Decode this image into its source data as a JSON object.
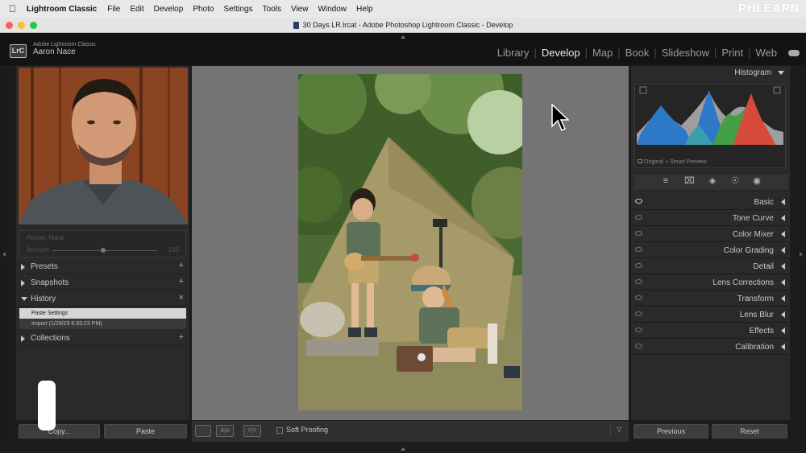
{
  "menubar": {
    "app": "Lightroom Classic",
    "items": [
      "File",
      "Edit",
      "Develop",
      "Photo",
      "Settings",
      "Tools",
      "View",
      "Window",
      "Help"
    ],
    "brand": "PHLEARN"
  },
  "window": {
    "title": "30 Days LR.lrcat - Adobe Photoshop Lightroom Classic - Develop"
  },
  "identity": {
    "badge": "LrC",
    "product": "Adobe Lightroom Classic",
    "user": "Aaron Nace"
  },
  "modules": [
    "Library",
    "Develop",
    "Map",
    "Book",
    "Slideshow",
    "Print",
    "Web"
  ],
  "active_module": "Develop",
  "left_panel": {
    "preset_name_label": "Preset: None",
    "amount_label": "Amount",
    "amount_value": "100",
    "sections": [
      {
        "label": "Presets",
        "action": "+"
      },
      {
        "label": "Snapshots",
        "action": "+"
      },
      {
        "label": "History",
        "action": "×"
      },
      {
        "label": "Collections",
        "action": "+"
      }
    ],
    "history_items": [
      "Paste Settings",
      "Import (1/29/25 6:33:23 PM)"
    ],
    "copy_label": "Copy...",
    "paste_label": "Paste"
  },
  "toolbar": {
    "view1": "",
    "view2": "A|A",
    "view3": "Y|Y",
    "soft_proofing": "Soft Proofing",
    "dropdown": "▽"
  },
  "right_panel": {
    "histogram_label": "Histogram",
    "histogram_info": "Original + Smart Preview",
    "sections": [
      "Basic",
      "Tone Curve",
      "Color Mixer",
      "Color Grading",
      "Detail",
      "Lens Corrections",
      "Transform",
      "Lens Blur",
      "Effects",
      "Calibration"
    ],
    "previous_label": "Previous",
    "reset_label": "Reset"
  }
}
